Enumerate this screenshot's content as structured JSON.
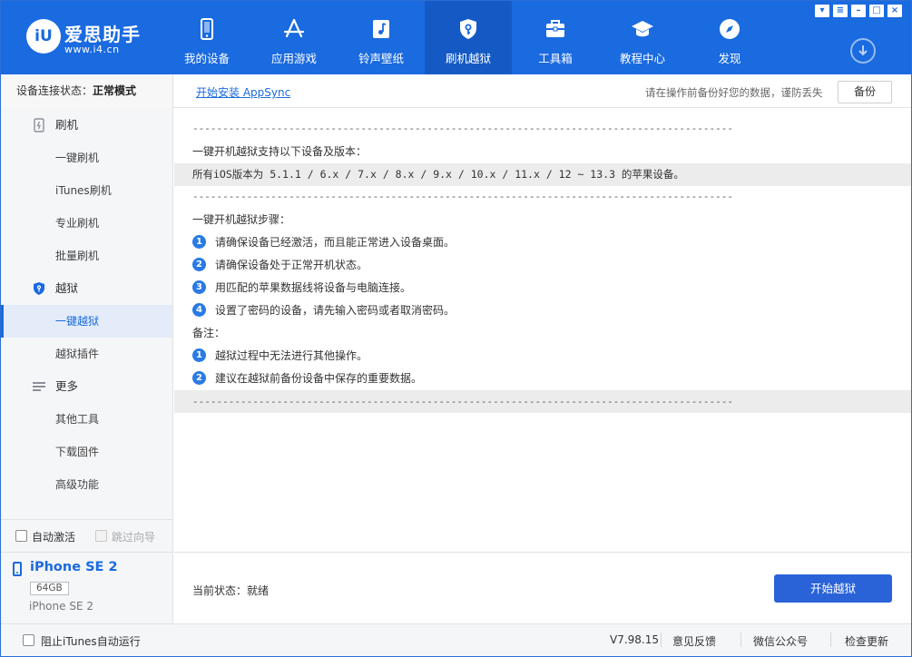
{
  "app": {
    "brand": "爱思助手",
    "url": "www.i4.cn",
    "logo_mark": "iU"
  },
  "colors": {
    "accent": "#1a6ae0",
    "button": "#2a63d8",
    "badge": "#2a7ae6"
  },
  "window_controls": [
    "shirt-icon",
    "menu-icon",
    "minimize-icon",
    "maximize-icon",
    "close-icon"
  ],
  "nav": [
    {
      "label": "我的设备",
      "icon": "phone-icon"
    },
    {
      "label": "应用游戏",
      "icon": "app-store-icon"
    },
    {
      "label": "铃声壁纸",
      "icon": "music-icon"
    },
    {
      "label": "刷机越狱",
      "icon": "shield-key-icon",
      "active": true
    },
    {
      "label": "工具箱",
      "icon": "toolbox-icon"
    },
    {
      "label": "教程中心",
      "icon": "graduation-cap-icon"
    },
    {
      "label": "发现",
      "icon": "compass-icon"
    }
  ],
  "status": {
    "conn_label": "设备连接状态：",
    "conn_value": "正常模式",
    "appsync": "开始安装 AppSync",
    "backup_hint": "请在操作前备份好您的数据，谨防丢失",
    "backup_btn": "备份"
  },
  "sidebar": {
    "groups": [
      {
        "label": "刷机",
        "icon": "flash-phone-icon",
        "items": [
          "一键刷机",
          "iTunes刷机",
          "专业刷机",
          "批量刷机"
        ]
      },
      {
        "label": "越狱",
        "icon": "shield-key-icon",
        "items": [
          "一键越狱",
          "越狱插件"
        ]
      },
      {
        "label": "更多",
        "icon": "list-icon",
        "items": [
          "其他工具",
          "下载固件",
          "高级功能"
        ]
      }
    ],
    "active_item": "一键越狱",
    "auto_activate": "自动激活",
    "skip_guide": "跳过向导"
  },
  "device": {
    "name": "iPhone SE 2",
    "capacity": "64GB",
    "model": "iPhone SE 2"
  },
  "content": {
    "dashes": "------------------------------------------------------------------------------------------",
    "support_title": "一键开机越狱支持以下设备及版本：",
    "support_text": "所有iOS版本为 5.1.1 / 6.x / 7.x / 8.x / 9.x / 10.x / 11.x / 12 ~ 13.3 的苹果设备。",
    "steps_title": "一键开机越狱步骤：",
    "steps": [
      "请确保设备已经激活，而且能正常进入设备桌面。",
      "请确保设备处于正常开机状态。",
      "用匹配的苹果数据线将设备与电脑连接。",
      "设置了密码的设备，请先输入密码或者取消密码。"
    ],
    "notes_title": "备注：",
    "notes": [
      "越狱过程中无法进行其他操作。",
      "建议在越狱前备份设备中保存的重要数据。"
    ]
  },
  "bottom": {
    "current_status": "当前状态：就绪",
    "start_btn": "开始越狱"
  },
  "footer": {
    "block_itunes": "阻止iTunes自动运行",
    "version": "V7.98.15",
    "feedback": "意见反馈",
    "wechat": "微信公众号",
    "update": "检查更新"
  }
}
